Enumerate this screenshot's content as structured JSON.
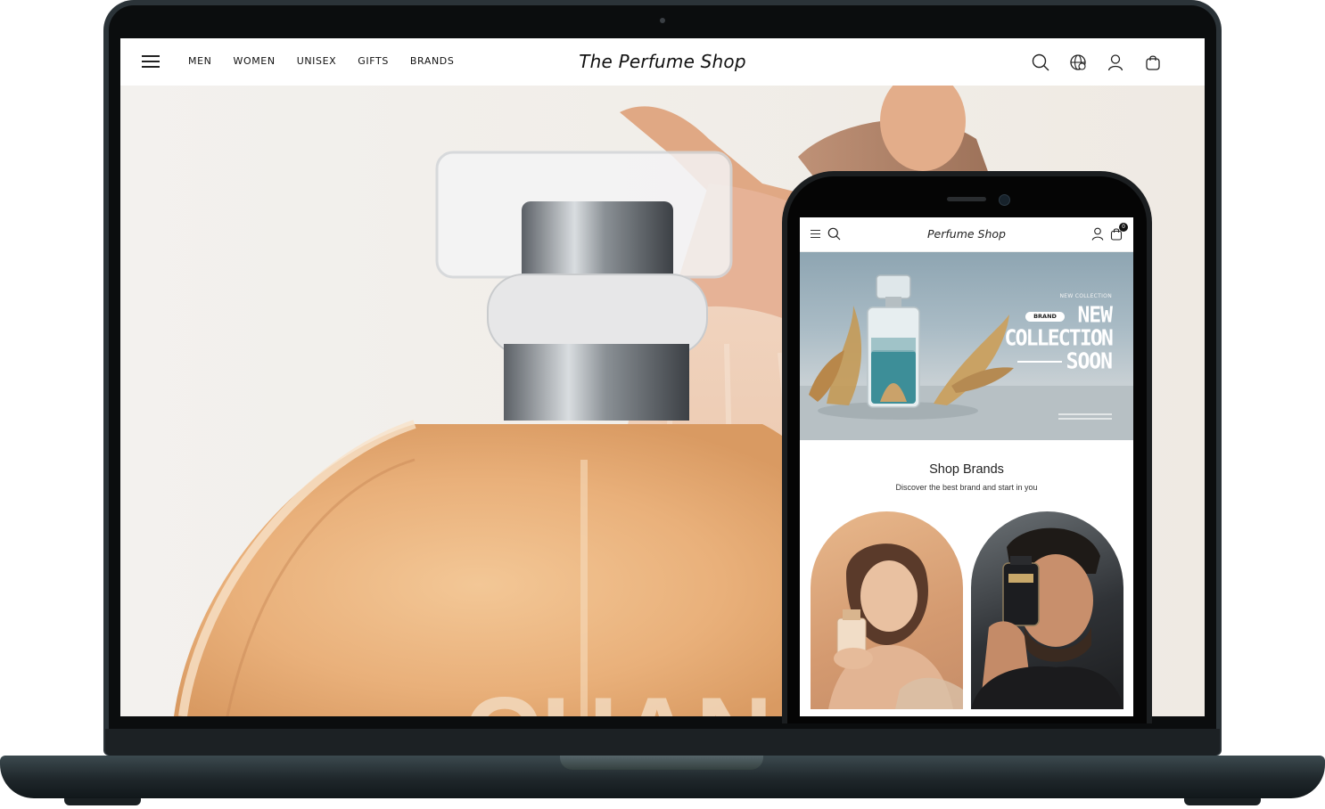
{
  "desktop": {
    "nav": [
      "MEN",
      "WOMEN",
      "UNISEX",
      "GIFTS",
      "BRANDS"
    ],
    "logo": "The Perfume Shop",
    "icons": [
      "search-icon",
      "language-globe-icon",
      "account-icon",
      "shopping-bag-icon"
    ],
    "hero": {
      "bottle_text": "CHAN"
    }
  },
  "mobile": {
    "logo": "Perfume Shop",
    "cart_count": "0",
    "banner": {
      "eyebrow": "NEW COLLECTION",
      "badge": "BRAND",
      "line1": "NEW",
      "line2": "COLLECTION",
      "line3": "SOON"
    },
    "section": {
      "title": "Shop Brands",
      "subtitle": "Discover the best brand and start in you"
    },
    "brand_cards": [
      "women-brand-card",
      "men-brand-card"
    ]
  },
  "colors": {
    "page_bg": "#ffffff",
    "device_body": "#1f272b",
    "hero_amber": "#e9b07a",
    "banner_teal": "#3d8e98"
  }
}
